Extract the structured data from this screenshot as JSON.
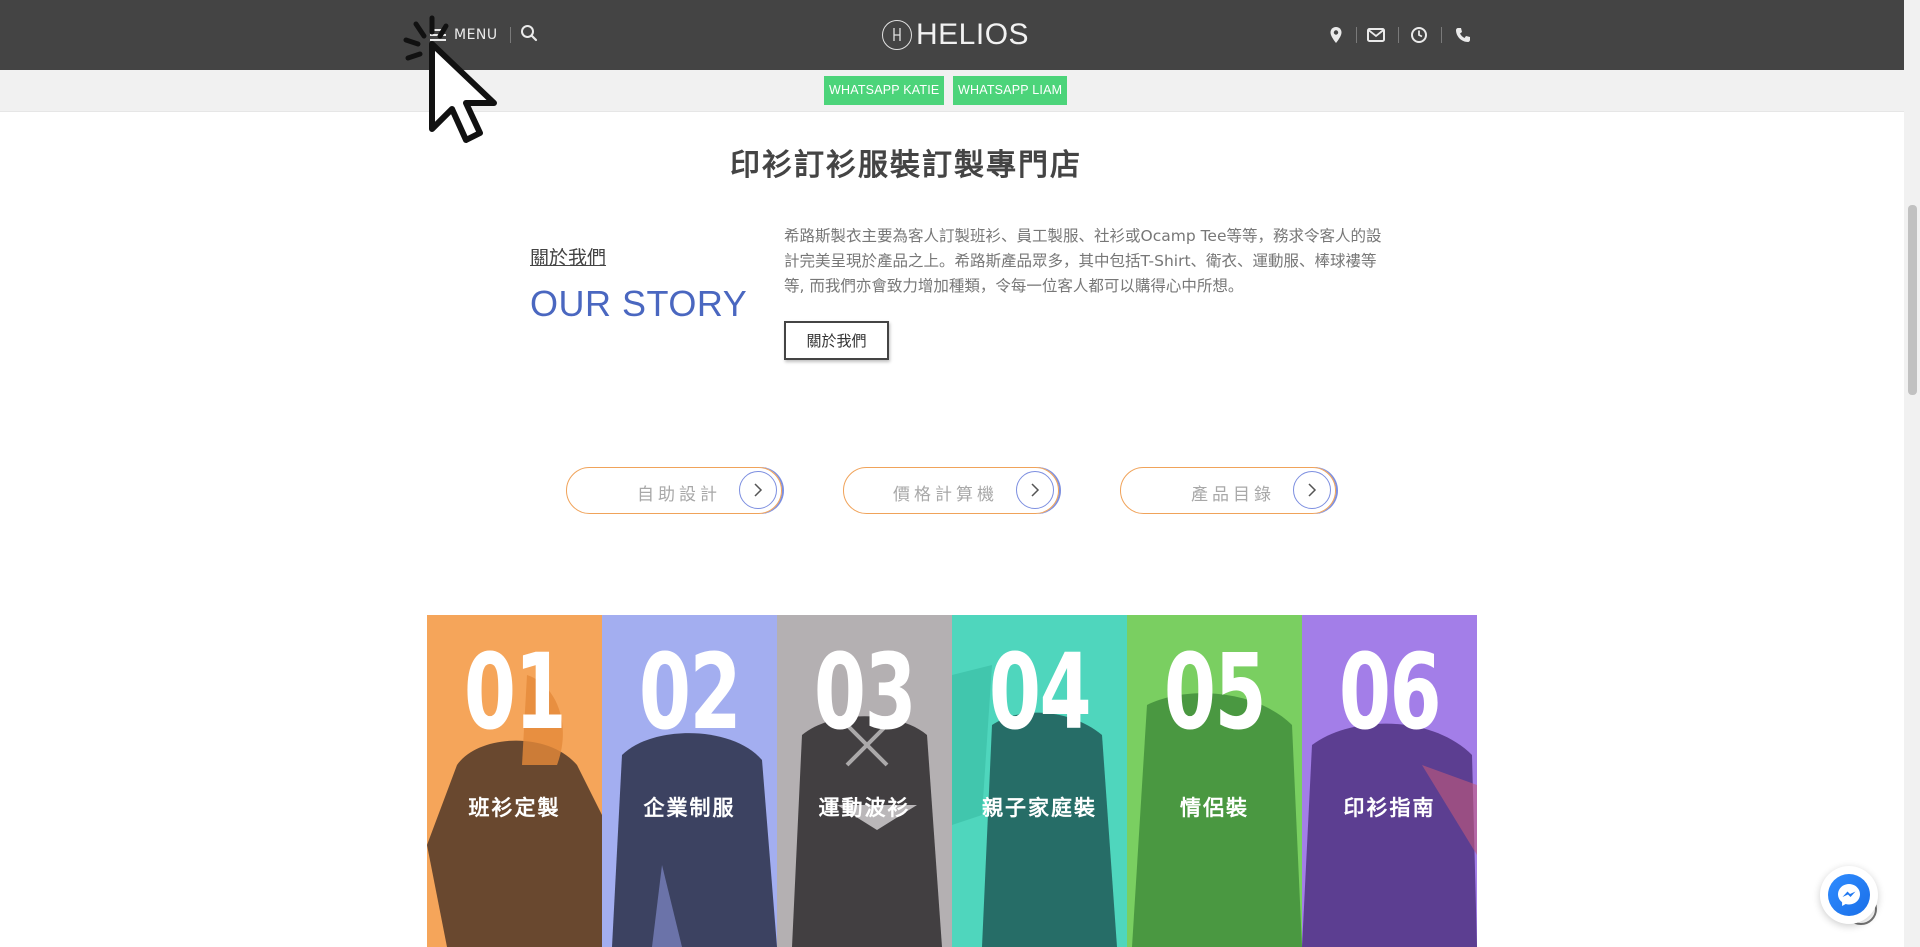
{
  "header": {
    "menu_label": "MENU",
    "logo_text": "HELIOS",
    "icons": [
      "search-icon",
      "location-icon",
      "mail-icon",
      "clock-icon",
      "phone-icon"
    ]
  },
  "subbar": {
    "whatsapp_katie": "WHATSAPP KATIE",
    "whatsapp_liam": "WHATSAPP LIAM"
  },
  "main": {
    "title": "印衫訂衫服裝訂製專門店",
    "about_link": "關於我們",
    "our_story": "OUR STORY",
    "description": "希路斯製衣主要為客人訂製班衫、員工製服、社衫或Ocamp Tee等等，務求令客人的設計完美呈現於產品之上。希路斯產品眾多，其中包括T-Shirt、衛衣、運動服、棒球褸等等, 而我們亦會致力增加種類，令每一位客人都可以購得心中所想。",
    "about_button": "關於我們"
  },
  "pills": [
    {
      "label": "自助設計"
    },
    {
      "label": "價格計算機"
    },
    {
      "label": "產品目錄"
    }
  ],
  "tiles": [
    {
      "num": "01",
      "label": "班衫定製",
      "color": "#f5a55a"
    },
    {
      "num": "02",
      "label": "企業制服",
      "color": "#a3aef0"
    },
    {
      "num": "03",
      "label": "運動波衫",
      "color": "#b4b0b2"
    },
    {
      "num": "04",
      "label": "親子家庭裝",
      "color": "#4fd6bd"
    },
    {
      "num": "05",
      "label": "情侶裝",
      "color": "#7acf61"
    },
    {
      "num": "06",
      "label": "印衫指南",
      "color": "#a37ee8"
    }
  ],
  "colors": {
    "header_bg": "#444444",
    "whatsapp_green": "#4cd47a",
    "story_blue": "#4a67c0",
    "pill_orange": "#f0a35a",
    "pill_blue": "#7d8fe0"
  }
}
